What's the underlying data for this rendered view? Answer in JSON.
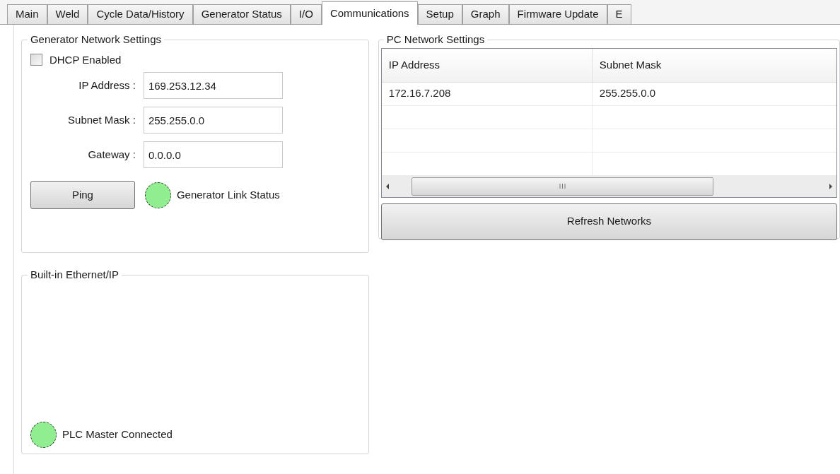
{
  "tabs": [
    {
      "label": "Main",
      "selected": false
    },
    {
      "label": "Weld",
      "selected": false
    },
    {
      "label": "Cycle Data/History",
      "selected": false
    },
    {
      "label": "Generator Status",
      "selected": false
    },
    {
      "label": "I/O",
      "selected": false
    },
    {
      "label": "Communications",
      "selected": true
    },
    {
      "label": "Setup",
      "selected": false
    },
    {
      "label": "Graph",
      "selected": false
    },
    {
      "label": "Firmware Update",
      "selected": false
    },
    {
      "label": "E",
      "selected": false
    }
  ],
  "generator_network": {
    "title": "Generator Network Settings",
    "dhcp": {
      "label": "DHCP Enabled",
      "checked": false
    },
    "fields": [
      {
        "label": "IP Address :",
        "value": "169.253.12.34"
      },
      {
        "label": "Subnet Mask :",
        "value": "255.255.0.0"
      },
      {
        "label": "Gateway :",
        "value": "0.0.0.0"
      }
    ],
    "ping_button": "Ping",
    "link_status": {
      "label": "Generator Link Status",
      "color": "#90ee90"
    }
  },
  "pc_network": {
    "title": "PC Network Settings",
    "table": {
      "columns": [
        "IP Address",
        "Subnet Mask"
      ],
      "rows": [
        [
          "172.16.7.208",
          "255.255.0.0"
        ]
      ]
    },
    "refresh_button": "Refresh Networks"
  },
  "ethernet_ip": {
    "title": "Built-in Ethernet/IP",
    "plc_status": {
      "label": "PLC Master Connected",
      "color": "#90ee90"
    }
  }
}
